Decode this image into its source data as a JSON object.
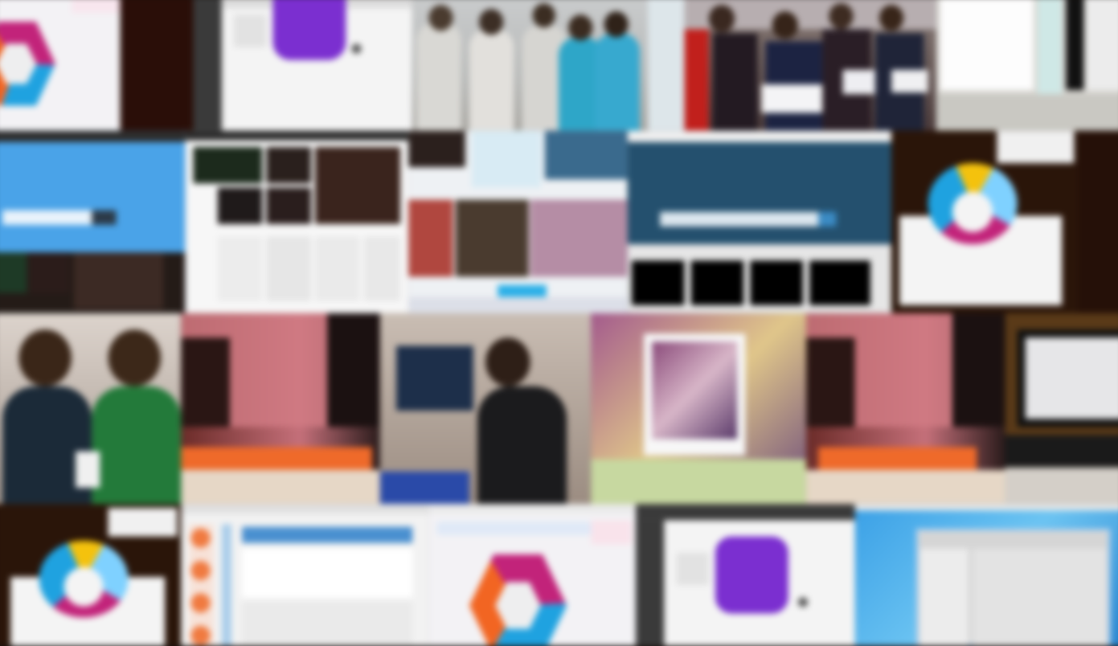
{
  "image": {
    "kind": "blurred photo collage mosaic",
    "tiles": [
      {
        "name": "hex-logo-page-top-left",
        "icon": "hex-logo"
      },
      {
        "name": "dark-strip-top",
        "icon": "none"
      },
      {
        "name": "purple-app-logo-page-top",
        "icon": "purple-app-logo"
      },
      {
        "name": "group-photo-lab-coats",
        "icon": "none"
      },
      {
        "name": "group-photo-awards",
        "icon": "none"
      },
      {
        "name": "window-dialog-top-right",
        "icon": "none"
      },
      {
        "name": "blue-search-page",
        "icon": "search-bar"
      },
      {
        "name": "thumbnail-grid-page",
        "icon": "none"
      },
      {
        "name": "photo-gallery-page",
        "icon": "none"
      },
      {
        "name": "navy-search-page",
        "icon": "search-bar"
      },
      {
        "name": "swirl-logo-page-right",
        "icon": "swirl-logo"
      },
      {
        "name": "people-at-laptops-photo",
        "icon": "none"
      },
      {
        "name": "orange-banner-page-1",
        "icon": "none"
      },
      {
        "name": "speaker-photo",
        "icon": "none"
      },
      {
        "name": "framed-collage-photo",
        "icon": "none"
      },
      {
        "name": "orange-banner-page-2",
        "icon": "none"
      },
      {
        "name": "monitor-photo",
        "icon": "none"
      },
      {
        "name": "swirl-logo-page-bottom-left",
        "icon": "swirl-logo"
      },
      {
        "name": "web-app-list-page",
        "icon": "none"
      },
      {
        "name": "hex-logo-page-bottom",
        "icon": "hex-logo"
      },
      {
        "name": "purple-app-logo-page-bottom",
        "icon": "purple-app-logo"
      },
      {
        "name": "windows-desktop-screenshot",
        "icon": "window"
      }
    ],
    "colors": {
      "hex_orange": "#f26522",
      "hex_magenta": "#c2237a",
      "hex_blue": "#1fa2e0",
      "purple_logo": "#7b2fd0",
      "sky_blue": "#4aa3e8",
      "navy": "#24506e",
      "orange_banner": "#ef6a2a",
      "win_blue": "#3aa0e6"
    }
  }
}
